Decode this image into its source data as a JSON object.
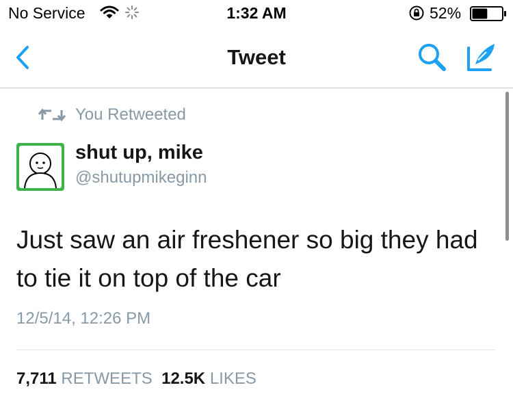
{
  "status_bar": {
    "carrier": "No Service",
    "time": "1:32 AM",
    "battery_percent": "52%",
    "battery_level": 0.52
  },
  "nav": {
    "title": "Tweet",
    "icons": [
      "back-chevron-icon",
      "search-icon",
      "compose-icon"
    ],
    "accent_color": "#1da1f2"
  },
  "tweet": {
    "retweet_label": "You Retweeted",
    "author_name": "shut up, mike",
    "author_handle": "@shutupmikeginn",
    "text": "Just saw an air freshener so big they had to tie it on top of the car",
    "timestamp": "12/5/14, 12:26 PM",
    "retweets_count": "7,711",
    "retweets_label": "RETWEETS",
    "likes_count": "12.5K",
    "likes_label": "LIKES"
  },
  "colors": {
    "text_primary": "#14171a",
    "text_secondary": "#8899a6",
    "avatar_green": "#3bb54a"
  }
}
